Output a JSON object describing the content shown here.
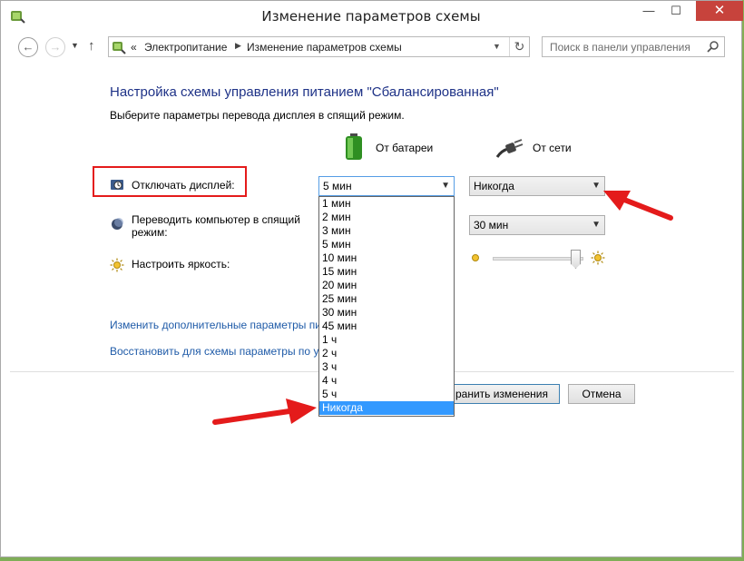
{
  "window": {
    "title": "Изменение параметров схемы",
    "min_glyph": "—",
    "max_glyph": "☐",
    "close_glyph": "✕"
  },
  "nav": {
    "back_glyph": "←",
    "forward_glyph": "→",
    "up_glyph": "↑",
    "breadcrumb_prefix": "«",
    "breadcrumb": [
      "Электропитание",
      "Изменение параметров схемы"
    ],
    "refresh_glyph": "↻",
    "search_placeholder": "Поиск в панели управления"
  },
  "content": {
    "heading": "Настройка схемы управления питанием \"Сбалансированная\"",
    "subheading": "Выберите параметры перевода дисплея в спящий режим.",
    "col_battery": "От батареи",
    "col_ac": "От сети",
    "settings": {
      "display_off": {
        "label": "Отключать дисплей:",
        "battery_value": "5 мин",
        "ac_value": "Никогда"
      },
      "sleep": {
        "label_line1": "Переводить компьютер в спящий",
        "label_line2": "режим:",
        "ac_value": "30 мин"
      },
      "brightness": {
        "label": "Настроить яркость:"
      }
    },
    "dropdown_options": [
      "1 мин",
      "2 мин",
      "3 мин",
      "5 мин",
      "10 мин",
      "15 мин",
      "20 мин",
      "25 мин",
      "30 мин",
      "45 мин",
      "1 ч",
      "2 ч",
      "3 ч",
      "4 ч",
      "5 ч",
      "Никогда"
    ],
    "dropdown_highlighted": "Никогда",
    "link_advanced": "Изменить дополнительные параметры пи",
    "link_restore": "Восстановить для схемы параметры по ум",
    "save_button": "ранить изменения",
    "cancel_button": "Отмена"
  },
  "colors": {
    "heading": "#1e3287",
    "link": "#1f5ba8",
    "highlight": "#e41b1b",
    "selection": "#3399ff",
    "close_button": "#c7433c"
  }
}
